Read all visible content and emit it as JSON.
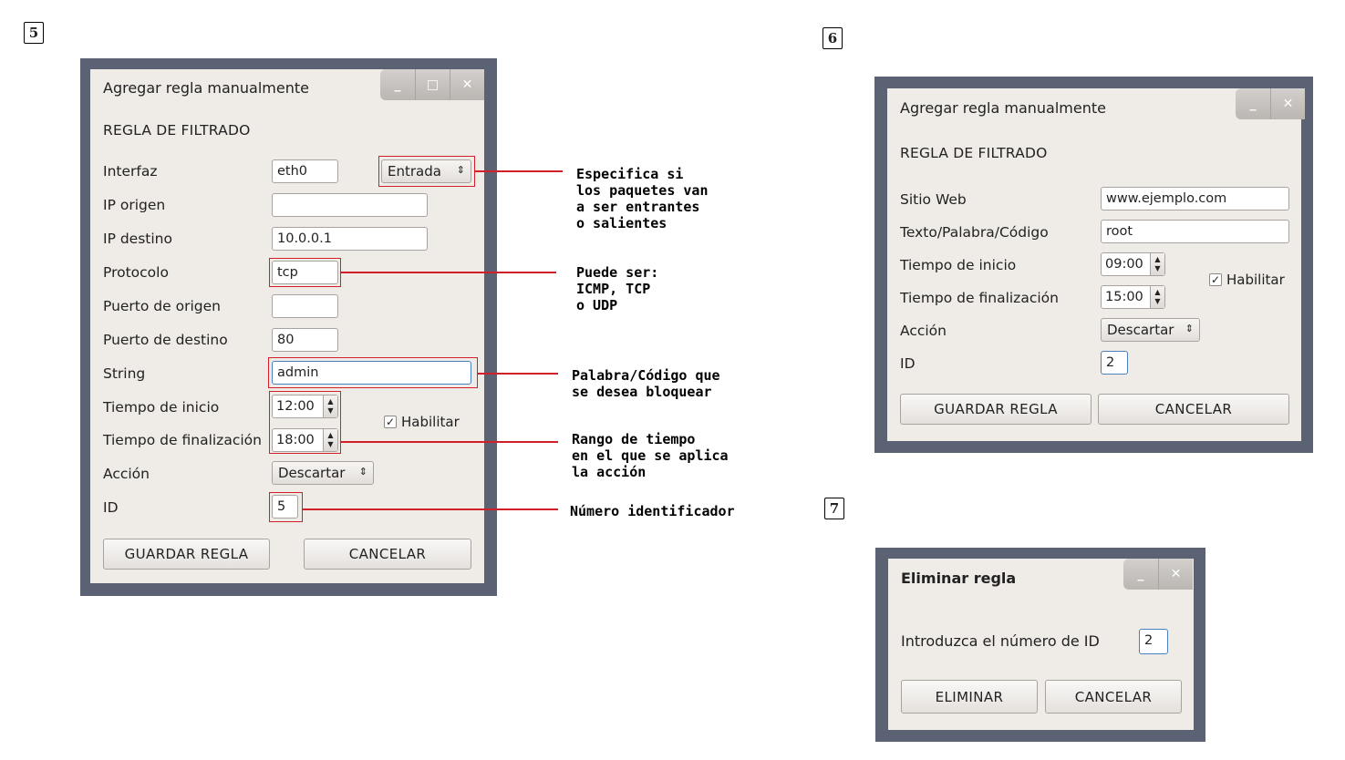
{
  "steps": [
    "5",
    "6",
    "7"
  ],
  "dialog_add": {
    "title": "Agregar regla manualmente",
    "heading": "REGLA DE FILTRADO",
    "fields": {
      "interfaz": {
        "label": "Interfaz",
        "value": "eth0"
      },
      "direction": {
        "value": "Entrada"
      },
      "ip_origen": {
        "label": "IP origen",
        "value": ""
      },
      "ip_destino": {
        "label": "IP destino",
        "value": "10.0.0.1"
      },
      "protocolo": {
        "label": "Protocolo",
        "value": "tcp"
      },
      "puerto_origen": {
        "label": "Puerto de origen",
        "value": ""
      },
      "puerto_destino": {
        "label": "Puerto de destino",
        "value": "80"
      },
      "string": {
        "label": "String",
        "value": "admin"
      },
      "tiempo_inicio": {
        "label": "Tiempo de inicio",
        "value": "12:00"
      },
      "tiempo_fin": {
        "label": "Tiempo de finalización",
        "value": "18:00"
      },
      "habilitar": {
        "label": "Habilitar",
        "checked": true
      },
      "accion": {
        "label": "Acción",
        "value": "Descartar"
      },
      "id": {
        "label": "ID",
        "value": "5"
      }
    },
    "save_label": "GUARDAR REGLA",
    "cancel_label": "CANCELAR"
  },
  "annotations": {
    "direction": "Especifica si\nlos paquetes van\na ser entrantes\no salientes",
    "protocol": "Puede ser:\nICMP, TCP\no UDP",
    "string": "Palabra/Código que\nse desea bloquear",
    "time": "Rango de tiempo\nen el que se aplica\nla acción",
    "id": "Número identificador"
  },
  "dialog_web": {
    "title": "Agregar regla manualmente",
    "heading": "REGLA DE FILTRADO",
    "fields": {
      "sitio": {
        "label": "Sitio Web",
        "value": "www.ejemplo.com"
      },
      "texto": {
        "label": "Texto/Palabra/Código",
        "value": "root"
      },
      "tiempo_inicio": {
        "label": "Tiempo de inicio",
        "value": "09:00"
      },
      "tiempo_fin": {
        "label": "Tiempo de finalización",
        "value": "15:00"
      },
      "habilitar": {
        "label": "Habilitar",
        "checked": true
      },
      "accion": {
        "label": "Acción",
        "value": "Descartar"
      },
      "id": {
        "label": "ID",
        "value": "2"
      }
    },
    "save_label": "GUARDAR REGLA",
    "cancel_label": "CANCELAR"
  },
  "dialog_delete": {
    "title": "Eliminar regla",
    "prompt": "Introduzca el número de ID",
    "id_value": "2",
    "delete_label": "ELIMINAR",
    "cancel_label": "CANCELAR"
  },
  "colors": {
    "annotation": "#d1202a",
    "frame": "#5b6273",
    "window_bg": "#efebe7"
  }
}
